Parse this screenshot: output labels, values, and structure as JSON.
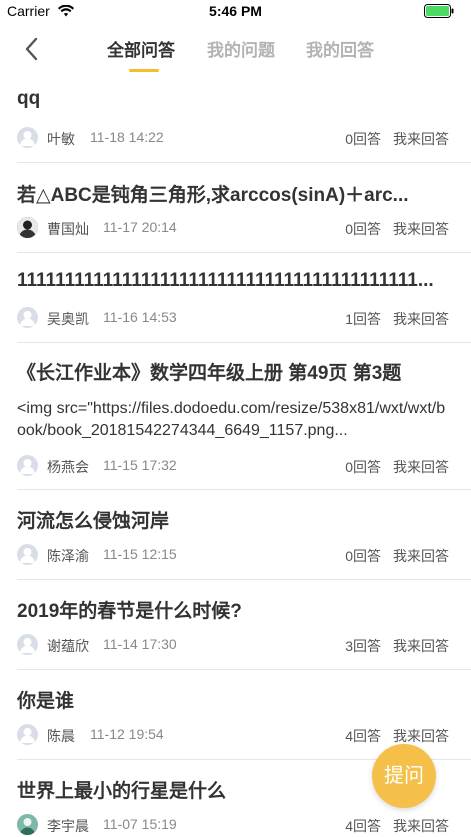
{
  "status_bar": {
    "carrier": "Carrier",
    "time": "5:46 PM",
    "battery_color": "#4cd964"
  },
  "nav": {
    "tabs": [
      {
        "label": "全部问答",
        "active": true
      },
      {
        "label": "我的问题",
        "active": false
      },
      {
        "label": "我的回答",
        "active": false
      }
    ],
    "accent_color": "#f5be2e"
  },
  "questions": [
    {
      "title": "qq",
      "body": "",
      "author": "叶敏",
      "date": "11-18 14:22",
      "answers": "0回答",
      "answer_label": "我来回答",
      "avatar": "default"
    },
    {
      "title": "若△ABC是钝角三角形,求arccos(sinA)＋arc...",
      "body": "",
      "author": "曹国灿",
      "date": "11-17 20:14",
      "answers": "0回答",
      "answer_label": "我来回答",
      "avatar": "photo"
    },
    {
      "title": "111111111111111111111111111111111111111111...",
      "body": "",
      "author": "吴奥凯",
      "date": "11-16 14:53",
      "answers": "1回答",
      "answer_label": "我来回答",
      "avatar": "default"
    },
    {
      "title": "《长江作业本》数学四年级上册 第49页 第3题",
      "body": "<img src=\"https://files.dodoedu.com/resize/538x81/wxt/wxt/book/book_20181542274344_6649_1157.png...",
      "author": "杨燕会",
      "date": "11-15 17:32",
      "answers": "0回答",
      "answer_label": "我来回答",
      "avatar": "default"
    },
    {
      "title": "河流怎么侵蚀河岸",
      "body": "",
      "author": "陈泽渝",
      "date": "11-15 12:15",
      "answers": "0回答",
      "answer_label": "我来回答",
      "avatar": "default"
    },
    {
      "title": "2019年的春节是什么时候?",
      "body": "",
      "author": "谢蕴欣",
      "date": "11-14 17:30",
      "answers": "3回答",
      "answer_label": "我来回答",
      "avatar": "default"
    },
    {
      "title": "你是谁",
      "body": "",
      "author": "陈晨",
      "date": "11-12 19:54",
      "answers": "4回答",
      "answer_label": "我来回答",
      "avatar": "default"
    },
    {
      "title": "世界上最小的行星是什么",
      "body": "",
      "author": "李宇晨",
      "date": "11-07 15:19",
      "answers": "4回答",
      "answer_label": "我来回答",
      "avatar": "photo-green"
    }
  ],
  "fab": {
    "label": "提问",
    "color": "#f5c04a"
  }
}
